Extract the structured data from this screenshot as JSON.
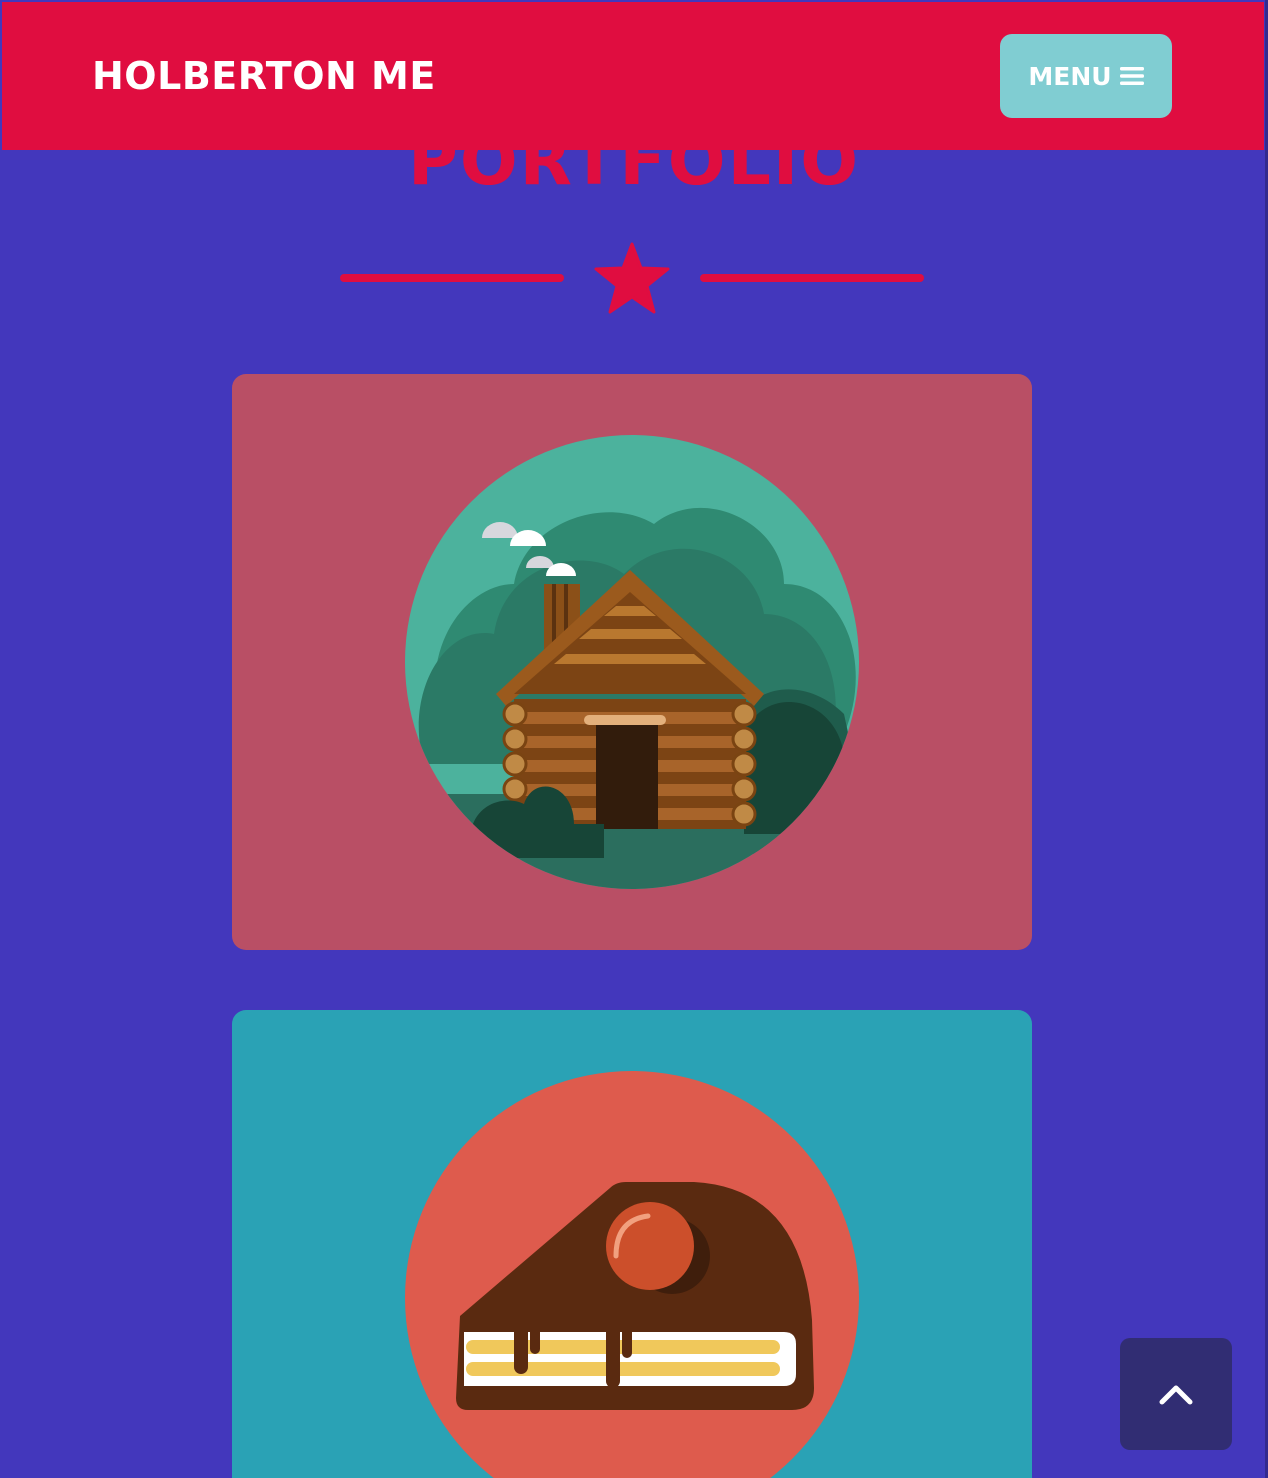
{
  "nav": {
    "brand": "HOLBERTON ME",
    "menu_label": "MENU",
    "menu_icon": "bars-icon"
  },
  "portfolio": {
    "title": "PORTFOLIO",
    "divider_icon": "star-icon",
    "items": [
      {
        "name": "cabin",
        "icon": "log-cabin-illustration",
        "bg": "#b94f65"
      },
      {
        "name": "cake",
        "icon": "cake-slice-illustration",
        "bg": "#2aa2b5"
      }
    ]
  },
  "scroll_top": {
    "icon": "chevron-up-icon"
  },
  "colors": {
    "page_bg": "#4337bc",
    "primary": "#e00d40",
    "menu_bg": "#80cdd2",
    "scroll_bg": "#312d73",
    "white": "#ffffff"
  }
}
